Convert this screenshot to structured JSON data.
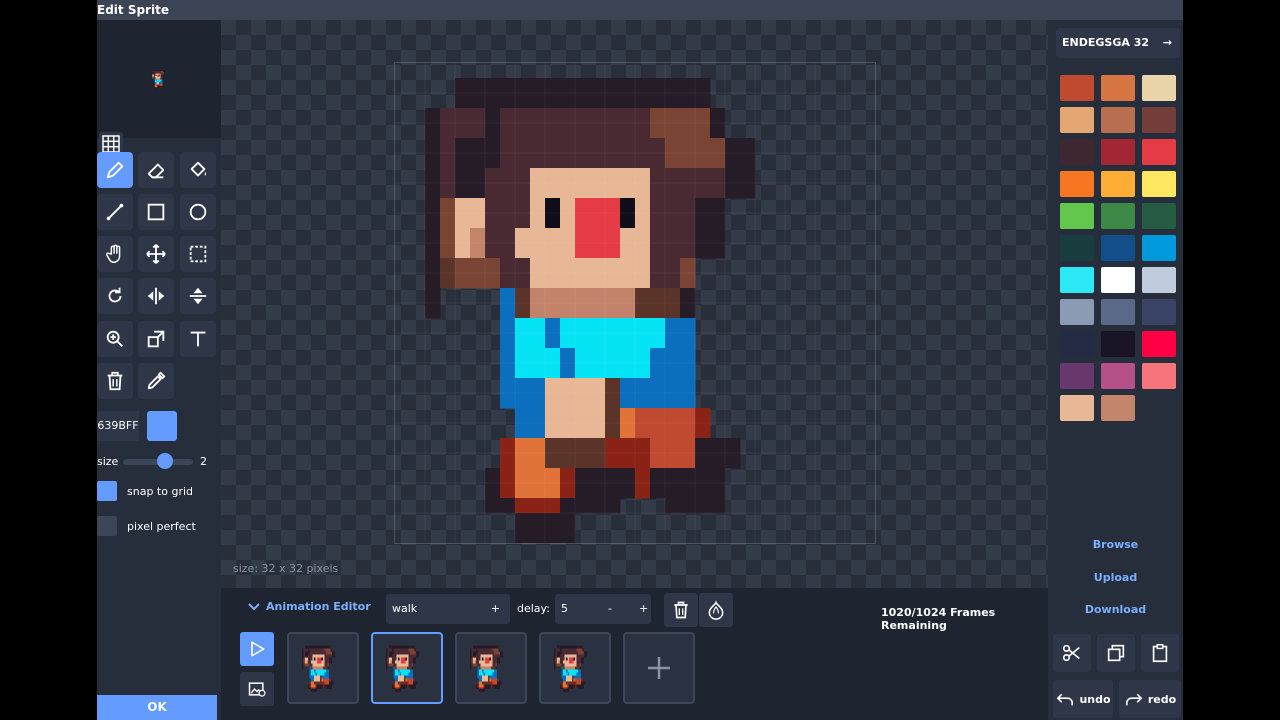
{
  "window": {
    "title": "Edit Sprite"
  },
  "left_panel": {
    "tools": [
      {
        "name": "pencil",
        "icon": "pencil-icon",
        "active": true
      },
      {
        "name": "eraser",
        "icon": "eraser-icon"
      },
      {
        "name": "fill",
        "icon": "paint-bucket-icon"
      },
      {
        "name": "line",
        "icon": "line-icon"
      },
      {
        "name": "rectangle",
        "icon": "rectangle-icon"
      },
      {
        "name": "circle",
        "icon": "circle-icon"
      },
      {
        "name": "pan",
        "icon": "hand-icon"
      },
      {
        "name": "move",
        "icon": "move-icon"
      },
      {
        "name": "select",
        "icon": "marquee-select-icon"
      },
      {
        "name": "rotate",
        "icon": "rotate-icon"
      },
      {
        "name": "flip-horizontal",
        "icon": "flip-horizontal-icon"
      },
      {
        "name": "flip-vertical",
        "icon": "flip-vertical-icon"
      },
      {
        "name": "zoom",
        "icon": "zoom-icon"
      },
      {
        "name": "resize",
        "icon": "resize-icon"
      },
      {
        "name": "text",
        "icon": "text-icon"
      },
      {
        "name": "delete",
        "icon": "trash-icon"
      },
      {
        "name": "eyedropper",
        "icon": "eyedropper-icon"
      }
    ],
    "color_hex": "639BFF",
    "color": "#639bff",
    "size_label": "size",
    "size_value": "2",
    "size_fraction": 0.6,
    "snap_to_grid": {
      "label": "snap to grid",
      "checked": true
    },
    "pixel_perfect": {
      "label": "pixel perfect",
      "checked": false
    },
    "ok_label": "OK"
  },
  "canvas": {
    "size_info": "size: 32 x 32 pixels",
    "palette_map": {
      "A": "#261c28",
      "B": "#4a2a32",
      "C": "#7a4434",
      "D": "#3c2a36",
      "E": "#e8b796",
      "F": "#c28569",
      "G": "#0f0d18",
      "H": "#e53b44",
      "I": "#0b6fbd",
      "J": "#05e4f5",
      "K": "#c3836a",
      "L": "#e07438",
      "M": "#be4a2f",
      "N": "#8a2316",
      "O": "#5a3428",
      "P": "#6f3d32"
    },
    "pixels": [
      "................................",
      "....AAAAAAAAAAAAAAAAA...........",
      "....AAAAAAAAAAAAAAAAA...........",
      "..ABBBABBBBBBBBBBCCCCA..........",
      "..ABBBABBBBBBBBBBCCCCA..........",
      "..ABAAABBBBBBBBBBBCCCCAA........",
      "..ABAAABBBBBBBBBBBCCCCAA........",
      "..ABAABBBEEEEEEEEBBBBBAA........",
      "..ABAABBBEEEEEEEEBBBBBAA........",
      "..ACEEBBBEGEHHHGEBBBAA..........",
      "..ACEEBBBEGEHHHGEBBBAA..........",
      "..ACEFBBEEEEHHHEEBBBAA..........",
      "..ACEFBBEEEEHHHEEBBBAA..........",
      "..AOCCCBBEEEEEEEEBBC............",
      "..AOCCCBBEEEEEEEEBBC............",
      "..A....IOKKKKKKKOOOA............",
      "..A....IOKKKKKKKOOOA............",
      ".......IJJIJJJJJJJII............",
      ".......IJJIJJJJJJJII............",
      ".......IJJJIJJJJJIII............",
      ".......IJJJIJJJJJIII............",
      ".......IIIEEEEOIIIII............",
      ".......IIIEEEEOIIIII............",
      "........IIEEEEOLMMMMN...........",
      "........IIEEEEOLMMMMN...........",
      ".......NLLOOOONNNMMMAAA.........",
      ".......NLLOOOONNNMMMAAA.........",
      "......ANLLLNAAAANAAAAA..........",
      "......ANLLLNAAAANAAAAA..........",
      "......AANNNAAAA...AAAA..........",
      "........AAAA.....................",
      "........AAAA....................."
    ]
  },
  "right_panel": {
    "palette_name": "ENDEGSGA 32",
    "palette_arrow": "→",
    "colors": [
      "#be4a2f",
      "#d77643",
      "#ead4aa",
      "#e4a672",
      "#b86f50",
      "#733e39",
      "#3e2731",
      "#a22633",
      "#e43b44",
      "#f77622",
      "#feae34",
      "#fee761",
      "#63c74d",
      "#3e8948",
      "#265c42",
      "#193c3e",
      "#124e89",
      "#0099db",
      "#2ce8f5",
      "#ffffff",
      "#c0cbdc",
      "#8b9bb4",
      "#5a6988",
      "#3a4466",
      "#262b44",
      "#181425",
      "#ff0044",
      "#68386c",
      "#b55088",
      "#f6757a",
      "#e8b796",
      "#c28569"
    ],
    "links": {
      "browse": "Browse",
      "upload": "Upload",
      "download": "Download"
    },
    "undo_label": "undo",
    "redo_label": "redo"
  },
  "animation": {
    "title": "Animation Editor",
    "name": "walk",
    "name_plus": "+",
    "delay_label": "delay:",
    "delay_value": "5",
    "delay_minus": "-",
    "delay_plus": "+",
    "frames_remaining": "1020/1024 Frames Remaining",
    "selected_frame": 1
  }
}
